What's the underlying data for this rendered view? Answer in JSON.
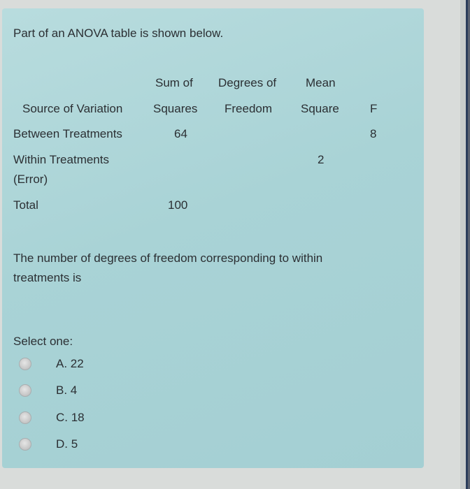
{
  "question": {
    "intro": "Part of an ANOVA table is shown below.",
    "text": "The number of degrees of freedom corresponding to within treatments is",
    "select_label": "Select one:"
  },
  "table": {
    "headers": {
      "source": "Source of Variation",
      "ss_line1": "Sum of",
      "ss_line2": "Squares",
      "df_line1": "Degrees of",
      "df_line2": "Freedom",
      "ms_line1": "Mean",
      "ms_line2": "Square",
      "f": "F"
    },
    "rows": [
      {
        "source": "Between Treatments",
        "ss": "64",
        "df": "",
        "ms": "",
        "f": "8"
      },
      {
        "source_line1": "Within Treatments",
        "source_line2": "(Error)",
        "ss": "",
        "df": "",
        "ms": "2",
        "f": ""
      },
      {
        "source": "Total",
        "ss": "100",
        "df": "",
        "ms": "",
        "f": ""
      }
    ]
  },
  "options": [
    {
      "label": "A. 22",
      "selected": false
    },
    {
      "label": "B. 4",
      "selected": false
    },
    {
      "label": "C. 18",
      "selected": false
    },
    {
      "label": "D. 5",
      "selected": false
    }
  ]
}
